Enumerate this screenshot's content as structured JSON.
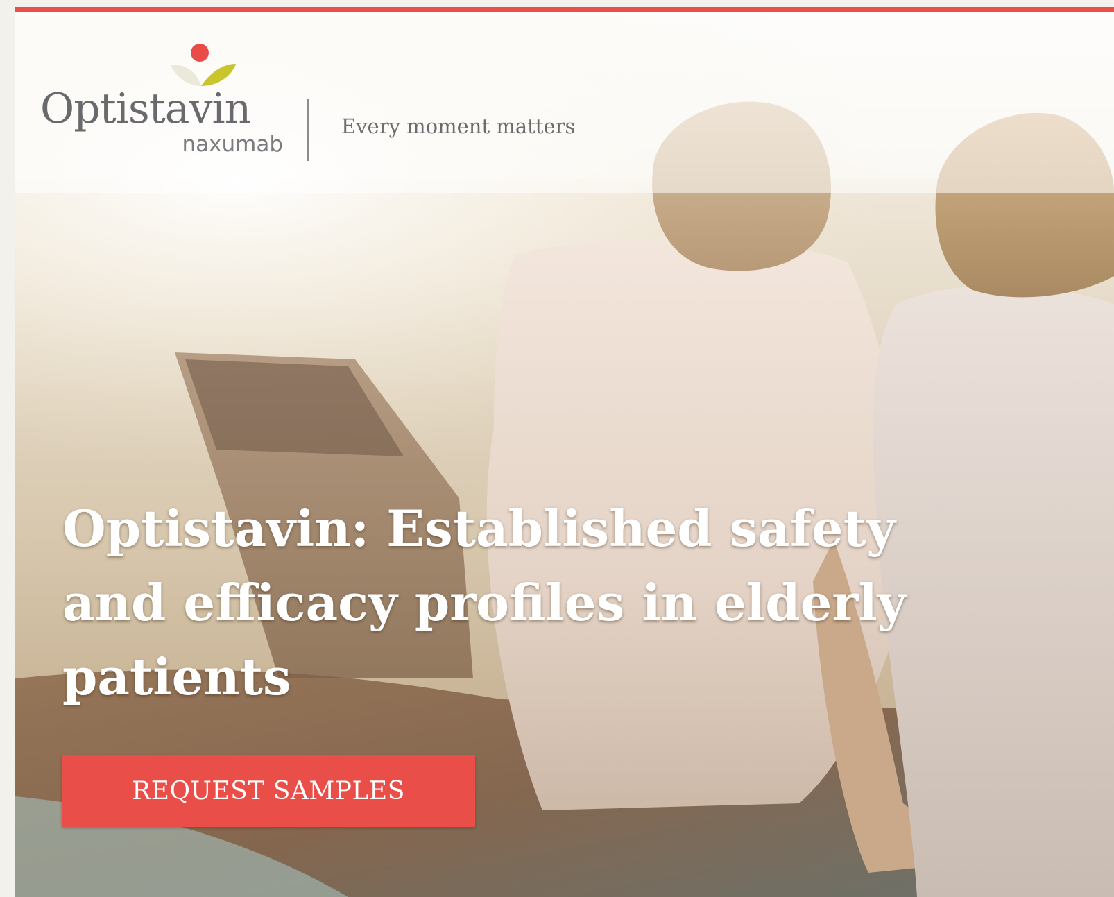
{
  "brand": {
    "name": "Optistavin",
    "generic": "naxumab",
    "tagline": "Every moment matters"
  },
  "hero": {
    "headline": "Optistavin: Established safety and efficacy profiles in elderly patients",
    "cta_label": "REQUEST SAMPLES"
  },
  "colors": {
    "accent": "#e9504c",
    "logo_dot": "#e94b48",
    "logo_leaf": "#c9c52c",
    "text_gray": "#696a6d"
  },
  "icons": {
    "logo_mark": "sprout-with-red-dot"
  }
}
